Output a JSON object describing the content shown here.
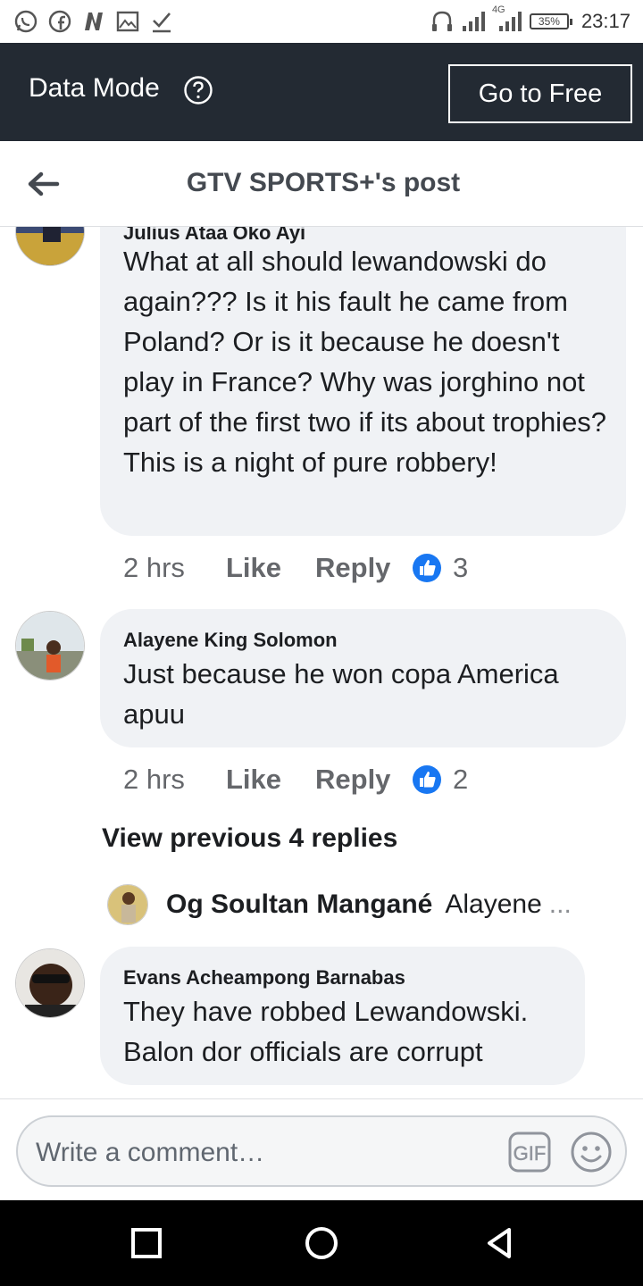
{
  "status_bar": {
    "left_icons": [
      "whatsapp-icon",
      "facebook-icon",
      "news-icon",
      "gallery-icon",
      "download-done-icon"
    ],
    "network": "4G",
    "battery": "35%",
    "time": "23:17"
  },
  "data_mode": {
    "title": "Data Mode",
    "button_label": "Go to Free"
  },
  "header": {
    "title": "GTV SPORTS+'s post"
  },
  "comments": [
    {
      "author": "Julius Ataa Oko Ayi",
      "text": "What at all should lewandowski do again??? Is it his fault he came from Poland? Or is it because he doesn't play in France? Why was jorghino not part of the first two if its about trophies? This is a night of pure robbery!",
      "time": "2 hrs",
      "like_label": "Like",
      "reply_label": "Reply",
      "likes": "3"
    },
    {
      "author": "Alayene King Solomon",
      "text": "Just because he won copa America apuu",
      "time": "2 hrs",
      "like_label": "Like",
      "reply_label": "Reply",
      "likes": "2"
    },
    {
      "author": "Evans Acheampong Barnabas",
      "text": "They have robbed Lewandowski. Balon dor officials are corrupt"
    }
  ],
  "replies": {
    "view_previous": "View previous 4 replies",
    "latest_author": "Og Soultan Mangané",
    "latest_preview": "Alayene",
    "ellipsis": "..."
  },
  "composer": {
    "placeholder": "Write a comment…"
  },
  "colors": {
    "data_bar_bg": "#232a33",
    "bubble_bg": "#f0f2f5",
    "like_blue": "#1877f2",
    "meta_gray": "#65676b"
  }
}
